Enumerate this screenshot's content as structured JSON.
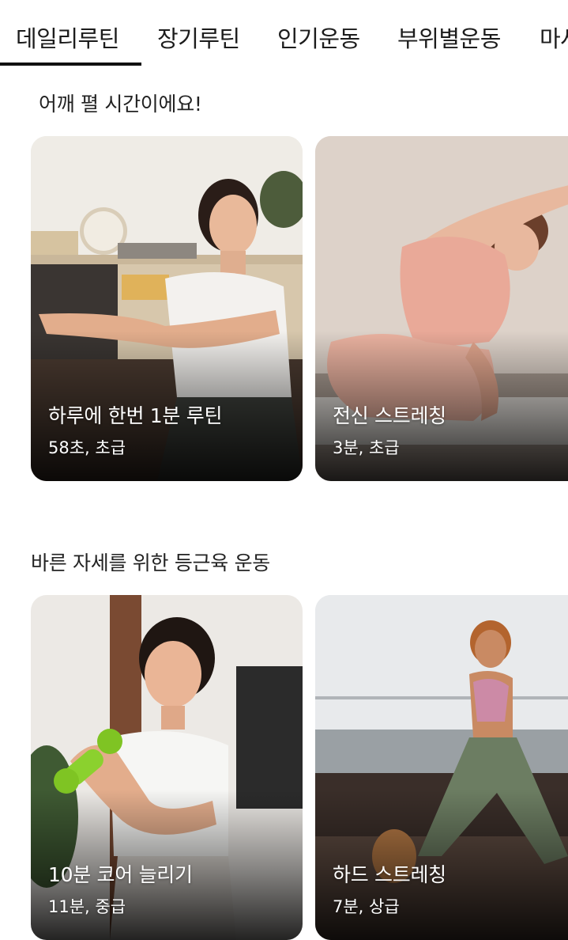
{
  "tabs": [
    {
      "label": "데일리루틴",
      "active": true
    },
    {
      "label": "장기루틴"
    },
    {
      "label": "인기운동"
    },
    {
      "label": "부위별운동"
    },
    {
      "label": "마사지"
    }
  ],
  "sections": [
    {
      "title": "어깨 펼 시간이에요!",
      "cards": [
        {
          "title": "하루에 한번 1분 루틴",
          "meta": "58초, 초급"
        },
        {
          "title": "전신 스트레칭",
          "meta": "3분, 초급"
        }
      ]
    },
    {
      "title": "바른 자세를 위한 등근육 운동",
      "cards": [
        {
          "title": "10분 코어 늘리기",
          "meta": "11분, 중급"
        },
        {
          "title": "하드 스트레칭",
          "meta": "7분, 상급"
        }
      ]
    }
  ],
  "colors": {
    "text": "#1c1c1c",
    "active_underline": "#111111"
  }
}
